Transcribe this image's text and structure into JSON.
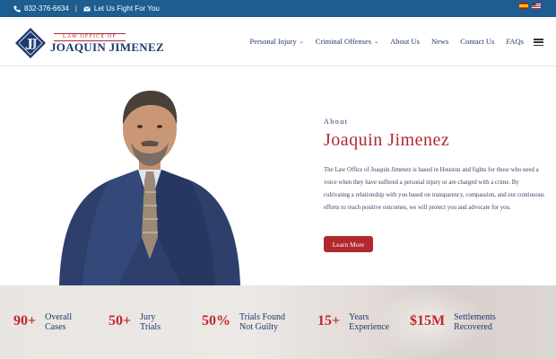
{
  "topbar": {
    "phone": "832-376-6634",
    "separator": "|",
    "tagline": "Let Us Fight For You",
    "icons": [
      "phone-icon",
      "envelope-icon"
    ],
    "flags": [
      "spain-flag-icon",
      "us-flag-icon"
    ]
  },
  "logo": {
    "small": "LAW OFFICE OF",
    "big": "JOAQUIN JIMENEZ",
    "mark_letter": "J"
  },
  "nav": {
    "items": [
      {
        "label": "Personal Injury",
        "dropdown": true
      },
      {
        "label": "Criminal Offenses",
        "dropdown": true
      },
      {
        "label": "About Us",
        "dropdown": false
      },
      {
        "label": "News",
        "dropdown": false
      },
      {
        "label": "Contact Us",
        "dropdown": false
      },
      {
        "label": "FAQs",
        "dropdown": false
      }
    ],
    "chevron": "⌄"
  },
  "hero": {
    "eyebrow": "About",
    "title": "Joaquin Jimenez",
    "description": "The Law Office of Joaquin Jimenez is based in Houston and fights for those who need a voice when they have suffered a personal injury or are charged with a crime. By cultivating a relationship with you based on transparency, compassion, and our continuous efforts to reach positive outcomes, we will protect you and advocate for you.",
    "button": "Learn More"
  },
  "stats": [
    {
      "value": "90+",
      "line1": "Overall",
      "line2": "Cases"
    },
    {
      "value": "50+",
      "line1": "Jury",
      "line2": "Trials"
    },
    {
      "value": "50%",
      "line1": "Trials Found",
      "line2": "Not Guilty"
    },
    {
      "value": "15+",
      "line1": "Years",
      "line2": "Experience"
    },
    {
      "value": "$15M",
      "line1": "Settlements",
      "line2": "Recovered"
    }
  ],
  "colors": {
    "topbar": "#1d5d8f",
    "navy": "#1e3a6e",
    "accent_red": "#b1292e",
    "stat_red": "#c0272d"
  }
}
